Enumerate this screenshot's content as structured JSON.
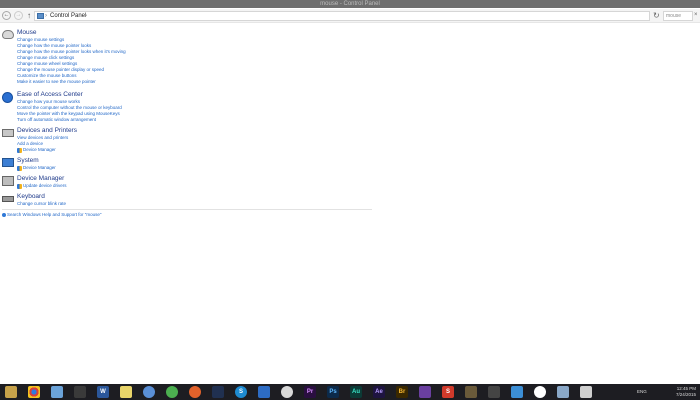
{
  "window": {
    "title": "mouse - Control Panel"
  },
  "address_bar": {
    "back": "←",
    "forward": "→",
    "up": "↑",
    "breadcrumb": [
      "Control Panel"
    ],
    "refresh": "↻",
    "search_value": "mouse",
    "search_clear": "×"
  },
  "results": [
    {
      "title": "Mouse",
      "tasks": [
        "Change mouse settings",
        "Change how the mouse pointer looks",
        "Change how the mouse pointer looks when it's moving",
        "Change mouse click settings",
        "Change mouse wheel settings",
        "Change the mouse pointer display or speed",
        "Customize the mouse buttons",
        "Make it easier to see the mouse pointer"
      ]
    },
    {
      "title": "Ease of Access Center",
      "tasks": [
        "Change how your mouse works",
        "Control the computer without the mouse or keyboard",
        "Move the pointer with the keypad using MouseKeys",
        "Turn off automatic window arrangement"
      ]
    },
    {
      "title": "Devices and Printers",
      "tasks": [
        "View devices and printers",
        "Add a device",
        "Device Manager"
      ]
    },
    {
      "title": "System",
      "tasks": [
        "Device Manager"
      ]
    },
    {
      "title": "Device Manager",
      "tasks": [
        "Update device drivers"
      ]
    },
    {
      "title": "Keyboard",
      "tasks": [
        "Change cursor blink rate"
      ]
    }
  ],
  "help_link": "Search Windows Help and Support for \"mouse\"",
  "taskbar": {
    "language": "ENG",
    "time": "12:45 PM",
    "date": "7/24/2015"
  }
}
